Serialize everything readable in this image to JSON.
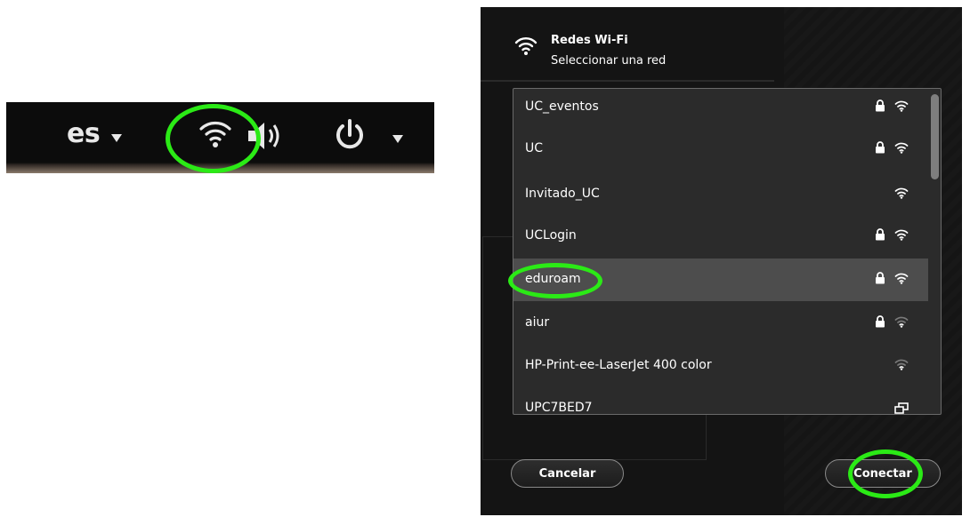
{
  "topbar": {
    "language": "es",
    "icons": [
      "wifi-icon",
      "volume-icon",
      "power-icon"
    ]
  },
  "dialog": {
    "title": "Redes Wi-Fi",
    "subtitle": "Seleccionar una red",
    "networks": [
      {
        "name": "UC_eventos",
        "secured": true,
        "signal": "strong"
      },
      {
        "name": "UC",
        "secured": true,
        "signal": "strong"
      },
      {
        "name": "Invitado_UC",
        "secured": false,
        "signal": "strong"
      },
      {
        "name": "UCLogin",
        "secured": true,
        "signal": "strong"
      },
      {
        "name": "eduroam",
        "secured": true,
        "signal": "strong",
        "selected": true
      },
      {
        "name": "aiur",
        "secured": true,
        "signal": "weak"
      },
      {
        "name": "HP-Print-ee-LaserJet 400 color",
        "secured": false,
        "signal": "weak"
      },
      {
        "name": "UPC7BED7",
        "secured": false,
        "signal": "ap"
      }
    ],
    "cancel_label": "Cancelar",
    "connect_label": "Conectar"
  },
  "annotation_color": "#2bea16"
}
